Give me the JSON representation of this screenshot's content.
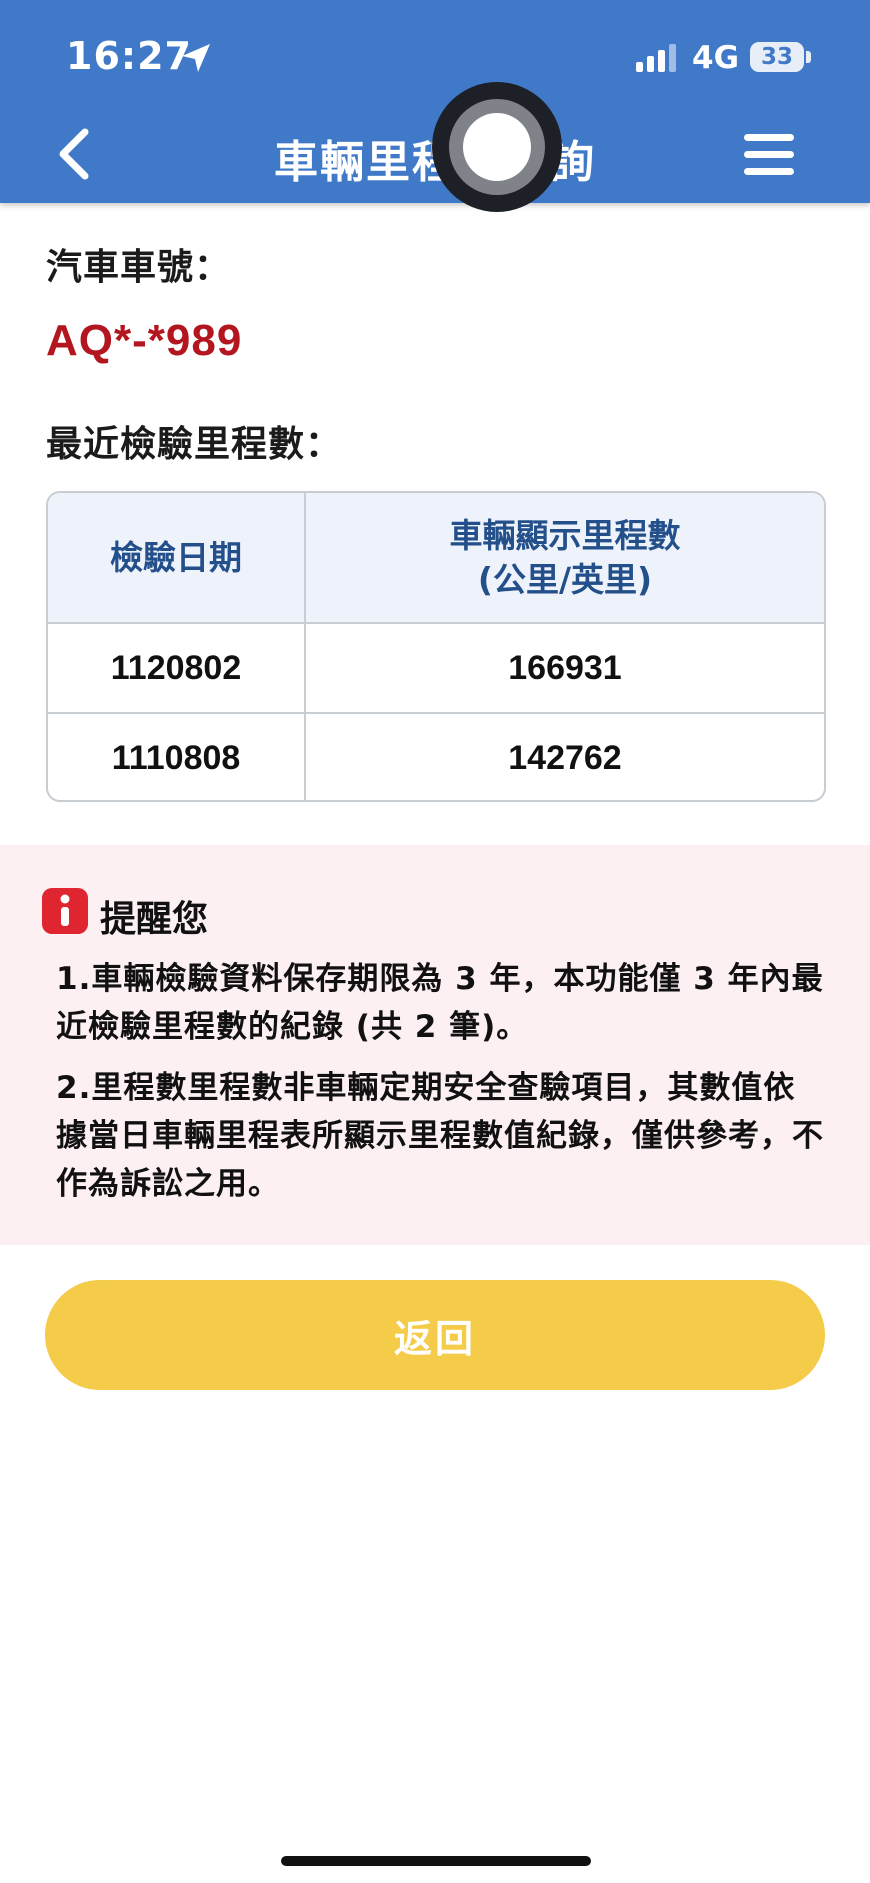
{
  "status_bar": {
    "time": "16:27",
    "network": "4G",
    "battery": "33",
    "icons": [
      "location-arrow-icon",
      "signal-bars-icon",
      "battery-icon"
    ]
  },
  "header": {
    "title": "車輛里程數查詢",
    "back_icon": "chevron-left-icon",
    "menu_icon": "hamburger-menu-icon",
    "color": "#3f79c7"
  },
  "vehicle": {
    "plate_label": "汽車車號：",
    "plate_number": "AQ*-*989",
    "plate_color": "#b3161f"
  },
  "mileage": {
    "section_label": "最近檢驗里程數：",
    "columns": [
      "檢驗日期",
      "車輛顯示里程數",
      "(公里/英里)"
    ],
    "rows": [
      {
        "date": "1120802",
        "mileage": "166931"
      },
      {
        "date": "1110808",
        "mileage": "142762"
      }
    ]
  },
  "notice": {
    "icon": "info-icon",
    "title": "提醒您",
    "items": [
      "1.車輛檢驗資料保存期限為 3 年，本功能僅 3 年內最近檢驗里程數的紀錄 (共 2 筆)。",
      "2.里程數里程數非車輛定期安全查驗項目，其數值依據當日車輛里程表所顯示里程數值紀錄，僅供參考，不作為訴訟之用。"
    ]
  },
  "actions": {
    "return_label": "返回",
    "return_color": "#f5cb4a"
  }
}
